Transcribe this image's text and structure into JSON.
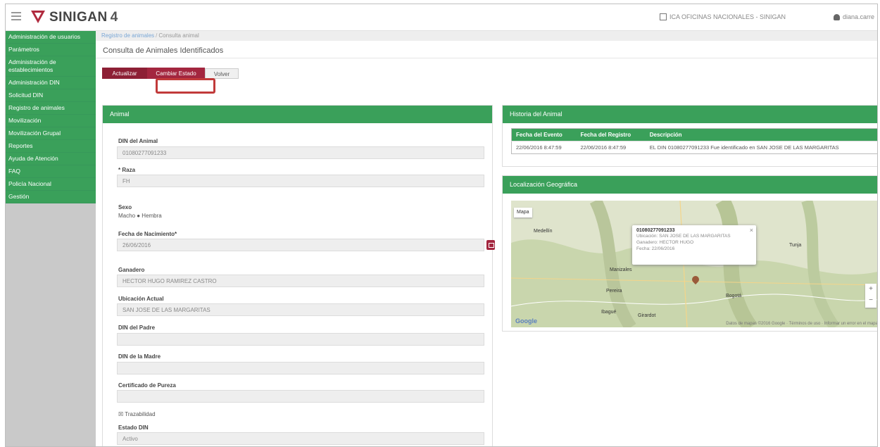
{
  "header": {
    "brand": "SINIGAN",
    "version": "4",
    "office": "ICA OFICINAS NACIONALES - SINIGAN",
    "user": "diana.carre"
  },
  "colors": {
    "primary_green": "#3aa05a",
    "accent_red": "#a3263f",
    "highlight": "#c13a3a"
  },
  "icons": [
    "hamburger-icon",
    "brand-logo-icon",
    "office-icon",
    "user-icon",
    "calendar-icon",
    "map-marker-icon",
    "close-icon"
  ],
  "sidebar": {
    "items": [
      {
        "label": "Administración de usuarios"
      },
      {
        "label": "Parámetros"
      },
      {
        "label": "Administración de establecimientos"
      },
      {
        "label": "Administración DIN"
      },
      {
        "label": "Solicitud DIN"
      },
      {
        "label": "Registro de animales"
      },
      {
        "label": "Movilización"
      },
      {
        "label": "Movilización Grupal"
      },
      {
        "label": "Reportes"
      },
      {
        "label": "Ayuda de Atención"
      },
      {
        "label": "FAQ"
      },
      {
        "label": "Policía Nacional"
      },
      {
        "label": "Gestión"
      }
    ]
  },
  "breadcrumb": {
    "parent": "Registro de animales",
    "current": "Consulta animal"
  },
  "page": {
    "title": "Consulta de Animales Identificados",
    "buttons": {
      "update": "Actualizar",
      "change_state": "Cambiar Estado",
      "back": "Volver"
    }
  },
  "animal_panel": {
    "title": "Animal",
    "fields": {
      "din_label": "DIN del Animal",
      "din_value": "01080277091233",
      "raza_label": "* Raza",
      "raza_value": "FH",
      "sexo_label": "Sexo",
      "sexo_options": "Macho ● Hembra",
      "nacimiento_label": "Fecha de Nacimiento*",
      "nacimiento_value": "26/06/2016",
      "ganadero_label": "Ganadero",
      "ganadero_value": "HECTOR HUGO RAMIREZ CASTRO",
      "ubicacion_label": "Ubicación Actual",
      "ubicacion_value": "SAN JOSE DE LAS MARGARITAS",
      "din_padre_label": "DIN del Padre",
      "din_padre_value": "",
      "din_madre_label": "DIN de la Madre",
      "din_madre_value": "",
      "certificado_label": "Certificado de Pureza",
      "certificado_value": "",
      "trazabilidad_label": "Trazabilidad",
      "estado_label": "Estado DIN",
      "estado_value": "Activo"
    }
  },
  "history_panel": {
    "title": "Historia del Animal",
    "columns": [
      "Fecha del Evento",
      "Fecha del Registro",
      "Descripción"
    ],
    "rows": [
      [
        "22/06/2016 8:47:59",
        "22/06/2016 8:47:59",
        "EL DIN 01080277091233 Fue identificado en SAN JOSE DE LAS MARGARITAS"
      ]
    ]
  },
  "geo_panel": {
    "title": "Localización Geográfica",
    "map_type": "Mapa",
    "popup": {
      "title": "01080277091233",
      "line1": "Ubicación: SAN JOSE DE LAS MARGARITAS",
      "line2": "Ganadero: HECTOR HUGO",
      "line3": "Fecha: 22/06/2016"
    },
    "cities": [
      "Medellín",
      "Pereira",
      "Bogotá",
      "Tunja",
      "Ibagué",
      "Manizales",
      "Girardot"
    ],
    "google": "Google",
    "footer": "Datos de mapas ©2016 Google · Términos de uso · Informar un error en el mapa"
  }
}
